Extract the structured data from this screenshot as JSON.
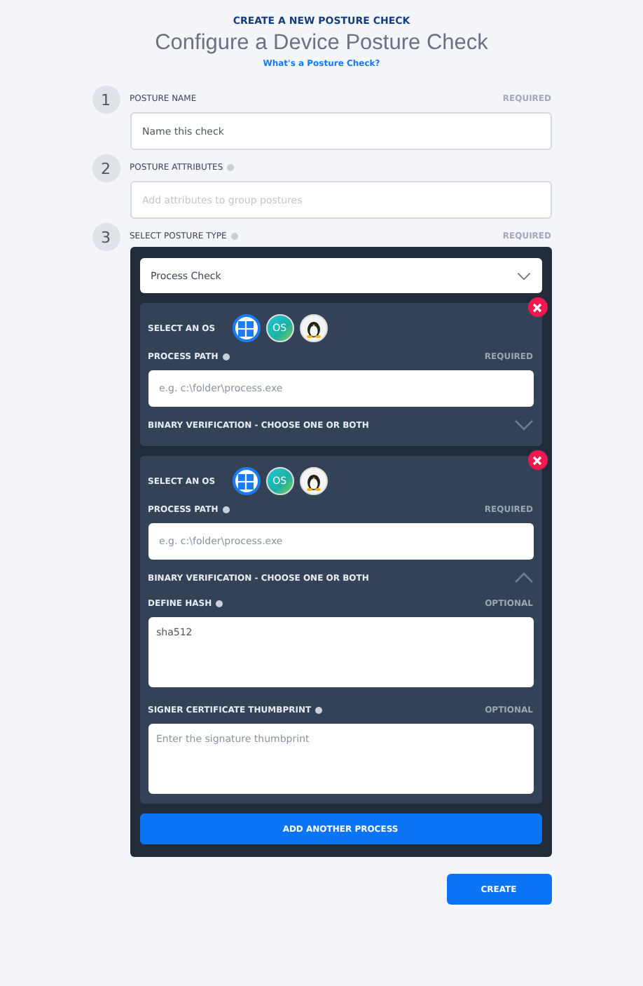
{
  "header": {
    "eyebrow": "CREATE A NEW POSTURE CHECK",
    "title": "Configure a Device Posture Check",
    "help_link": "What's a Posture Check?"
  },
  "steps": [
    {
      "number": "1",
      "label": "POSTURE NAME",
      "info": false,
      "badge": "REQUIRED",
      "kind": "input",
      "placeholder": "Name this check",
      "value_shown": true
    },
    {
      "number": "2",
      "label": "POSTURE ATTRIBUTES",
      "info": true,
      "kind": "input",
      "placeholder": "Add attributes to group postures",
      "value_shown": false
    },
    {
      "number": "3",
      "label": "SELECT POSTURE TYPE",
      "info": true,
      "badge": "REQUIRED",
      "kind": "type"
    }
  ],
  "posture_type": {
    "value": "Process Check"
  },
  "processes": [
    {
      "os_label": "SELECT AN OS",
      "os": [
        {
          "kind": "windows",
          "selected": true
        },
        {
          "kind": "macos",
          "label": "OS",
          "selected": false
        },
        {
          "kind": "linux",
          "selected": false
        }
      ],
      "path_label": "PROCESS PATH",
      "path_badge": "REQUIRED",
      "path_placeholder": "e.g. c:\\folder\\process.exe",
      "verification_label": "BINARY VERIFICATION - CHOOSE ONE OR BOTH",
      "expanded": false
    },
    {
      "os_label": "SELECT AN OS",
      "os": [
        {
          "kind": "windows",
          "selected": true
        },
        {
          "kind": "macos",
          "label": "OS",
          "selected": false
        },
        {
          "kind": "linux",
          "selected": false
        }
      ],
      "path_label": "PROCESS PATH",
      "path_badge": "REQUIRED",
      "path_placeholder": "e.g. c:\\folder\\process.exe",
      "verification_label": "BINARY VERIFICATION - CHOOSE ONE OR BOTH",
      "expanded": true,
      "hash_label": "DEFINE HASH",
      "hash_badge": "OPTIONAL",
      "hash_value": "sha512",
      "thumb_label": "SIGNER CERTIFICATE THUMBPRINT",
      "thumb_badge": "OPTIONAL",
      "thumb_placeholder": "Enter the signature thumbprint"
    }
  ],
  "add_button": "ADD ANOTHER PROCESS",
  "create_button": "CREATE"
}
